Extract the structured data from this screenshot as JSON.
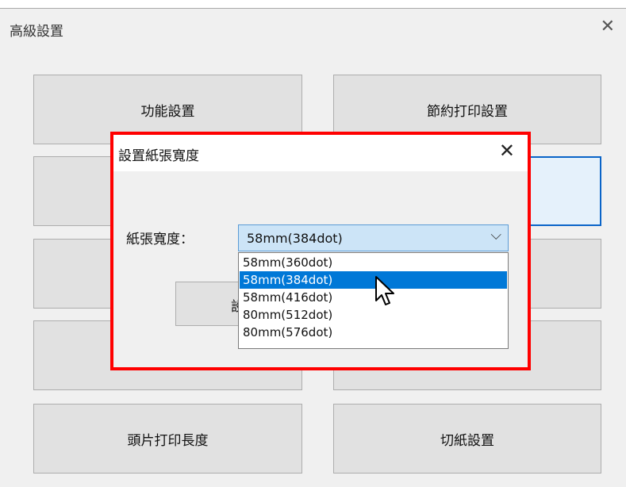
{
  "main_window": {
    "title": "高級設置",
    "buttons": {
      "function_settings": "功能設置",
      "save_print_settings": "節約打印設置",
      "header_print_length": "頭片打印長度",
      "cut_paper_settings": "切紙設置"
    }
  },
  "dialog": {
    "title": "設置紙張寬度",
    "field_label": "紙張寬度：",
    "selected_value": "58mm(384dot)",
    "partial_button_label": "設",
    "options": [
      {
        "label": "58mm(360dot)",
        "selected": false
      },
      {
        "label": "58mm(384dot)",
        "selected": true
      },
      {
        "label": "58mm(416dot)",
        "selected": false
      },
      {
        "label": "80mm(512dot)",
        "selected": false
      },
      {
        "label": "80mm(576dot)",
        "selected": false
      }
    ]
  },
  "icons": {
    "main_close": "close-icon",
    "dialog_close": "close-icon",
    "dropdown": "chevron-down-icon",
    "cursor": "pointer-cursor-icon"
  },
  "colors": {
    "highlight_border": "#ff0000",
    "selection": "#0078d7",
    "select_bg": "#cce4f7",
    "focus_border": "#0a64c8"
  }
}
